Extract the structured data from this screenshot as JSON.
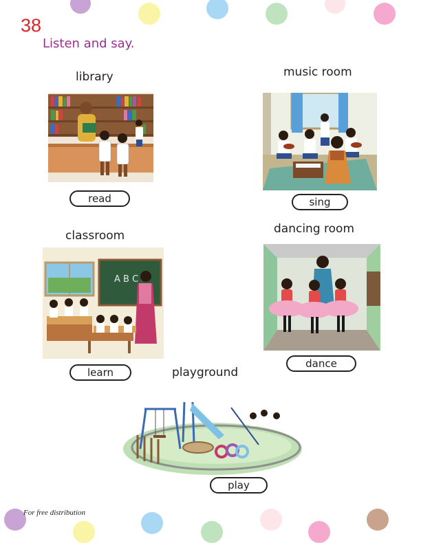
{
  "page_number": "38",
  "instruction": "Listen and say.",
  "places": [
    {
      "name": "library",
      "action": "read"
    },
    {
      "name": "music room",
      "action": "sing"
    },
    {
      "name": "classroom",
      "action": "learn"
    },
    {
      "name": "dancing room",
      "action": "dance"
    },
    {
      "name": "playground",
      "action": "play"
    }
  ],
  "classroom_board_text": "A B C",
  "footer": "For free distribution",
  "colors": {
    "page_number": "#d9262b",
    "instruction": "#9c2f8e",
    "dots": [
      "#c7a3d6",
      "#faf5a6",
      "#a9d8f5",
      "#bfe3bf",
      "#fde6ea",
      "#f6a9cf",
      "#c9a38d"
    ]
  }
}
